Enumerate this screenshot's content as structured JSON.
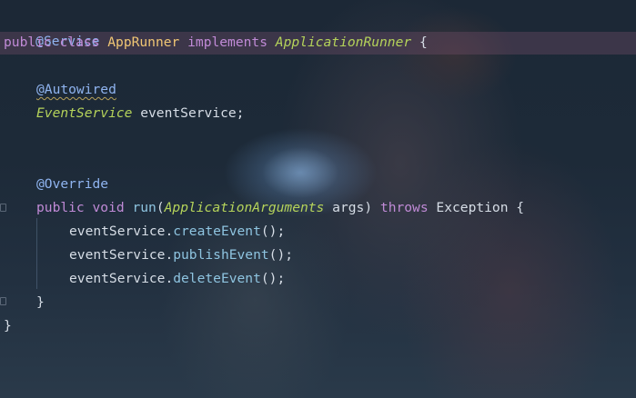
{
  "editor": {
    "lines": {
      "l1": {
        "annotation": "@Service"
      },
      "l2": {
        "kw_public": "public",
        "kw_class": "class",
        "class_name": "AppRunner",
        "kw_implements": "implements",
        "interface_name": "ApplicationRunner",
        "open_brace": "{"
      },
      "l4": {
        "annotation": "@Autowired"
      },
      "l5": {
        "type": "EventService",
        "field": "eventService",
        "semicolon": ";"
      },
      "l8": {
        "annotation": "@Override"
      },
      "l9": {
        "kw_public": "public",
        "kw_void": "void",
        "method_name": "run",
        "open_paren": "(",
        "param_type": "ApplicationArguments",
        "param_name": "args",
        "close_paren": ")",
        "kw_throws": "throws",
        "exception": "Exception",
        "open_brace": "{"
      },
      "l10": {
        "receiver": "eventService",
        "dot": ".",
        "call": "createEvent",
        "args": "();"
      },
      "l11": {
        "receiver": "eventService",
        "dot": ".",
        "call": "publishEvent",
        "args": "();"
      },
      "l12": {
        "receiver": "eventService",
        "dot": ".",
        "call": "deleteEvent",
        "args": "();"
      },
      "l13": {
        "close_brace": "}"
      },
      "l14": {
        "close_brace": "}"
      }
    },
    "colors": {
      "keyword": "#c08ad6",
      "annotation": "#8fb4f0",
      "class_name": "#f0c674",
      "interface": "#b5d35a",
      "method_call": "#8ec4e0",
      "current_line": "#784e6e"
    }
  }
}
